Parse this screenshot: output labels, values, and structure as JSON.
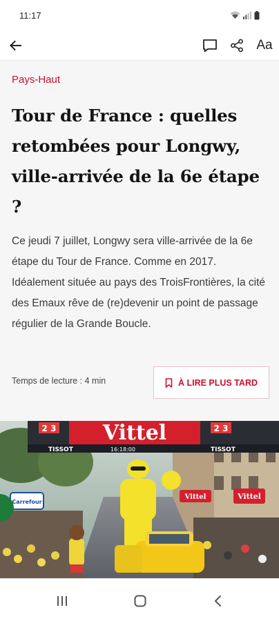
{
  "status_bar": {
    "time": "11:17"
  },
  "toolbar": {
    "icons": [
      "back-arrow-icon",
      "comment-icon",
      "share-icon",
      "font-size-icon"
    ],
    "font_label": "Aa"
  },
  "article": {
    "category": "Pays-Haut",
    "headline": "Tour de France : quelles retombées pour Longwy, ville-arrivée de la 6e étape ?",
    "lede": "Ce jeudi 7 juillet, Longwy sera ville-arrivée de la 6e  étape du Tour de France. Comme en 2017. Idéalement située au pays des TroisFrontières, la cité des Emaux rêve de (re)devenir un point de passage régulier de la Grande Boucle.",
    "reading_time": "Temps de lecture : 4 min",
    "read_later_label": "À LIRE PLUS TARD"
  },
  "hero_image": {
    "banner_brand": "Vittel",
    "banner_sponsor": "TISSOT",
    "banner_channel": "2 3",
    "side_signs": [
      "Vittel",
      "Vittel"
    ],
    "store_sign": "Carrefour",
    "clock_text": "16:18:00"
  },
  "colors": {
    "accent": "#c8102e",
    "article_bg": "#f7f6f6",
    "headline": "#141414"
  }
}
